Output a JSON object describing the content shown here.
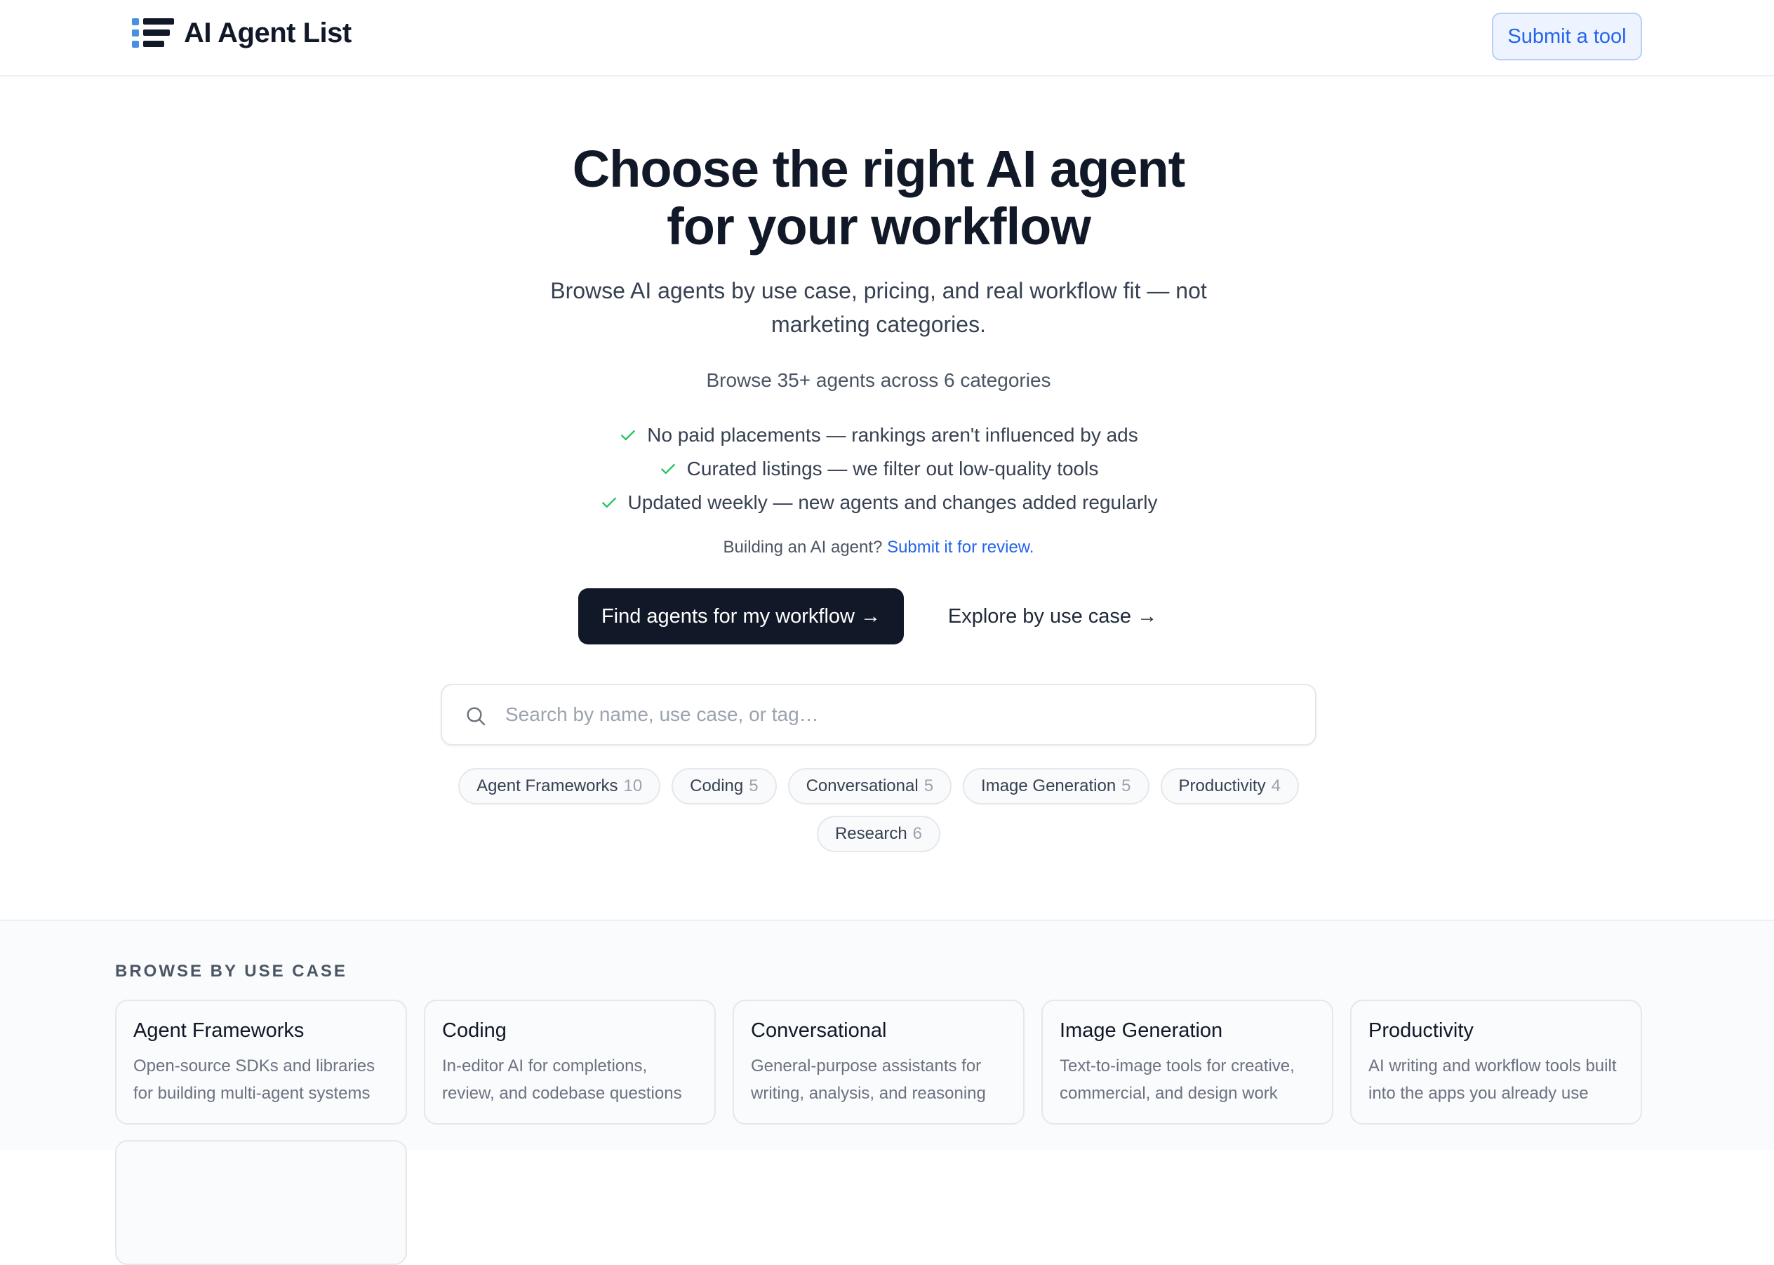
{
  "header": {
    "logo_text": "AI Agent List",
    "submit_label": "Submit a tool"
  },
  "hero": {
    "title_line1": "Choose the right AI agent",
    "title_line2": "for your workflow",
    "subtitle": "Browse AI agents by use case, pricing, and real workflow fit — not marketing categories.",
    "browse_count": "Browse 35+ agents across 6 categories",
    "checks": [
      "No paid placements — rankings aren't influenced by ads",
      "Curated listings — we filter out low-quality tools",
      "Updated weekly — new agents and changes added regularly"
    ],
    "building_text": "Building an AI agent?",
    "building_link": "Submit it for review.",
    "cta_primary": "Find agents for my workflow →",
    "cta_secondary": "Explore by use case →"
  },
  "search": {
    "placeholder": "Search by name, use case, or tag…"
  },
  "filters": [
    {
      "label": "Agent Frameworks",
      "count": "10"
    },
    {
      "label": "Coding",
      "count": "5"
    },
    {
      "label": "Conversational",
      "count": "5"
    },
    {
      "label": "Image Generation",
      "count": "5"
    },
    {
      "label": "Productivity",
      "count": "4"
    },
    {
      "label": "Research",
      "count": "6"
    }
  ],
  "use_cases": {
    "title": "BROWSE BY USE CASE",
    "cards": [
      {
        "name": "Agent Frameworks",
        "desc": "Open-source SDKs and libraries for building multi-agent systems"
      },
      {
        "name": "Coding",
        "desc": "In-editor AI for completions, review, and codebase questions"
      },
      {
        "name": "Conversational",
        "desc": "General-purpose assistants for writing, analysis, and reasoning"
      },
      {
        "name": "Image Generation",
        "desc": "Text-to-image tools for creative, commercial, and design work"
      },
      {
        "name": "Productivity",
        "desc": "AI writing and workflow tools built into the apps you already use"
      }
    ]
  },
  "colors": {
    "accent": "#2563eb",
    "primary_dark": "#111827",
    "check_green": "#22c55e"
  }
}
